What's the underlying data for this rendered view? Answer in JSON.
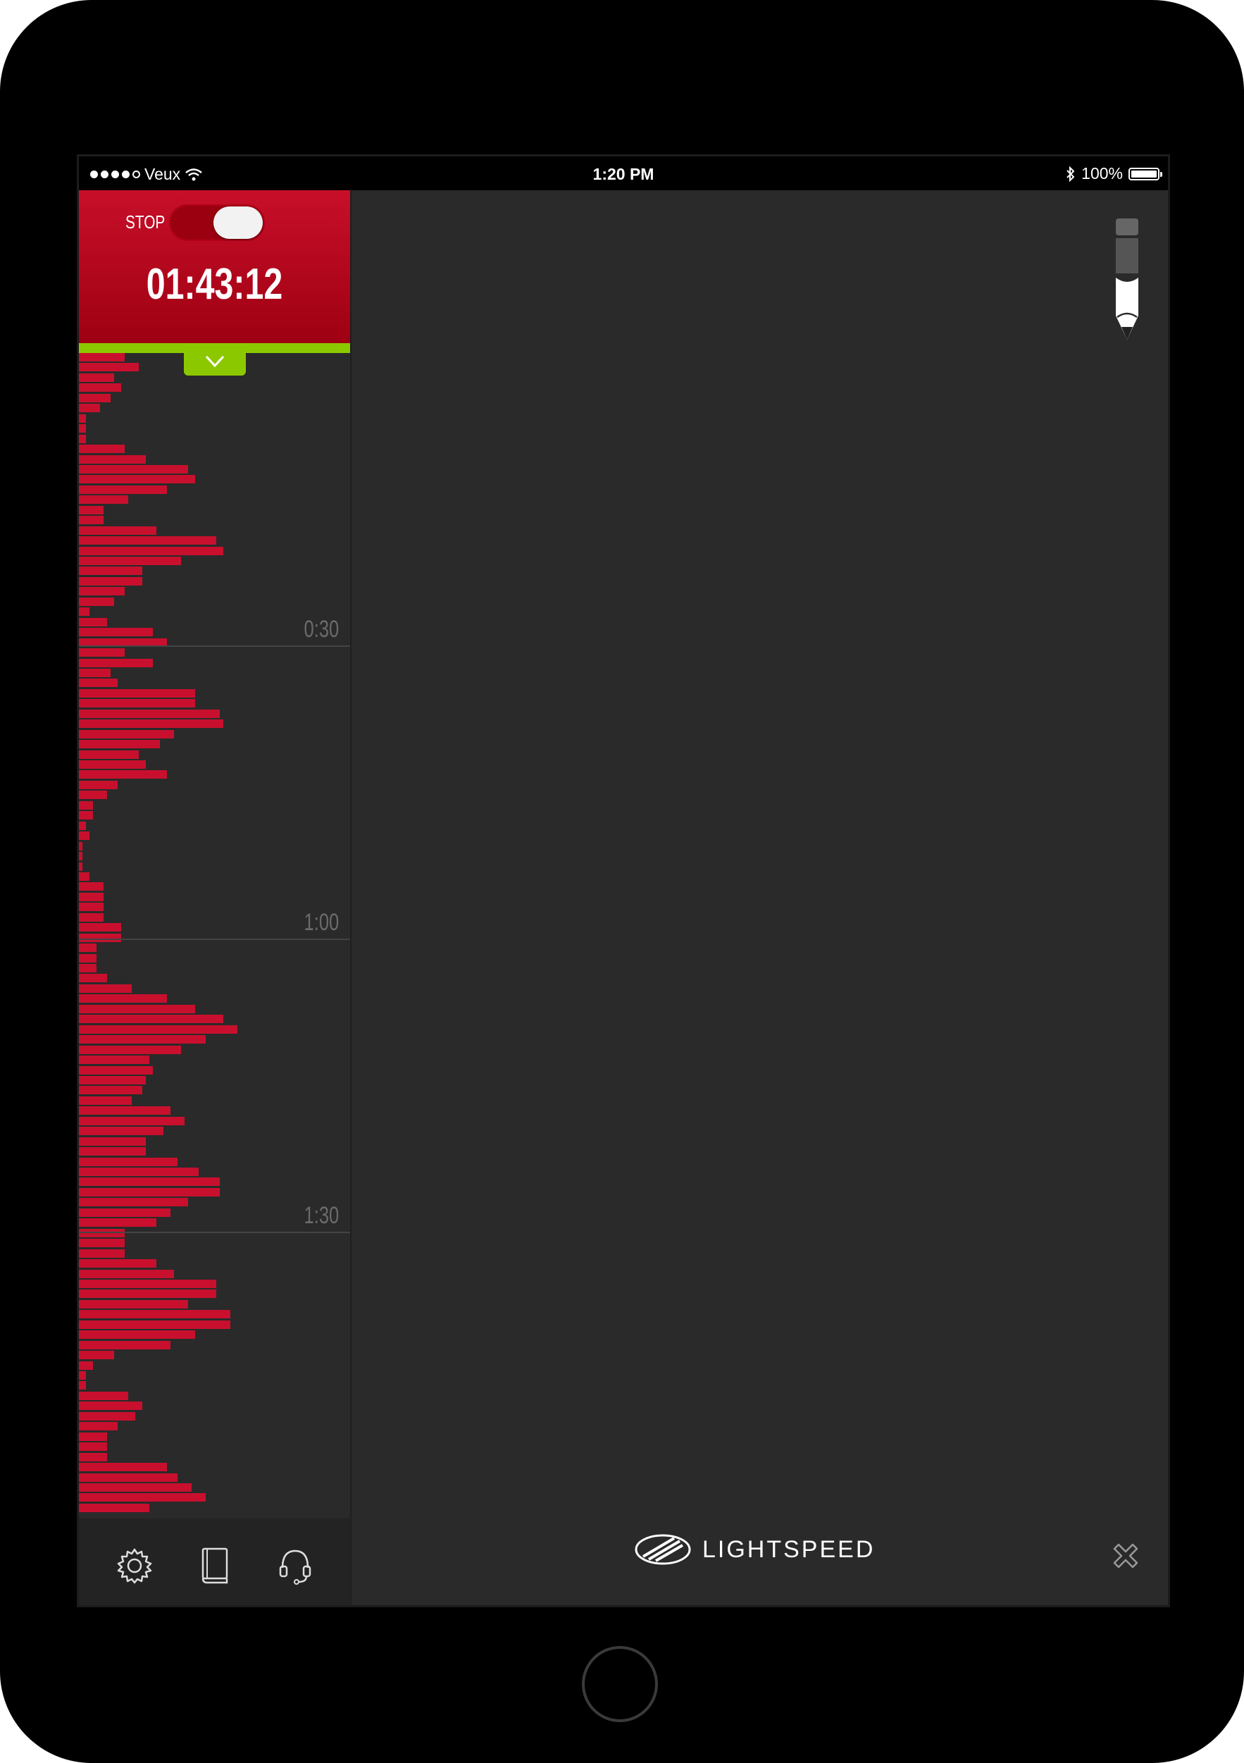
{
  "status_bar": {
    "carrier": "Veux",
    "time": "1:20 PM",
    "battery": "100%"
  },
  "timer_panel": {
    "stop_label": "STOP",
    "toggle_on": true,
    "elapsed": "01:43:12"
  },
  "graph": {
    "time_markers": [
      "0:30",
      "1:00",
      "1:30"
    ],
    "bar_color": "#c8102e",
    "bar_levels": [
      13,
      17,
      10,
      12,
      9,
      6,
      2,
      2,
      2,
      13,
      19,
      31,
      33,
      25,
      14,
      7,
      7,
      22,
      39,
      41,
      29,
      18,
      18,
      13,
      10,
      3,
      8,
      21,
      25,
      13,
      21,
      9,
      11,
      33,
      33,
      40,
      41,
      27,
      23,
      17,
      19,
      25,
      11,
      8,
      4,
      4,
      2,
      3,
      1,
      1,
      1,
      3,
      7,
      7,
      7,
      7,
      12,
      12,
      5,
      5,
      5,
      8,
      15,
      25,
      33,
      41,
      45,
      36,
      29,
      20,
      21,
      19,
      18,
      15,
      26,
      30,
      24,
      19,
      19,
      28,
      34,
      40,
      40,
      31,
      26,
      22,
      13,
      13,
      13,
      22,
      27,
      39,
      39,
      31,
      43,
      43,
      33,
      26,
      10,
      4,
      2,
      2,
      14,
      18,
      16,
      11,
      8,
      8,
      8,
      25,
      28,
      32,
      36,
      20
    ]
  },
  "footer": {
    "icons": [
      "gear-icon",
      "book-icon",
      "headset-icon"
    ]
  },
  "main": {
    "logo_text": "LIGHTSPEED"
  },
  "colors": {
    "accent_red": "#c8102e",
    "accent_green": "#8cc800",
    "background": "#2a2a2a"
  }
}
